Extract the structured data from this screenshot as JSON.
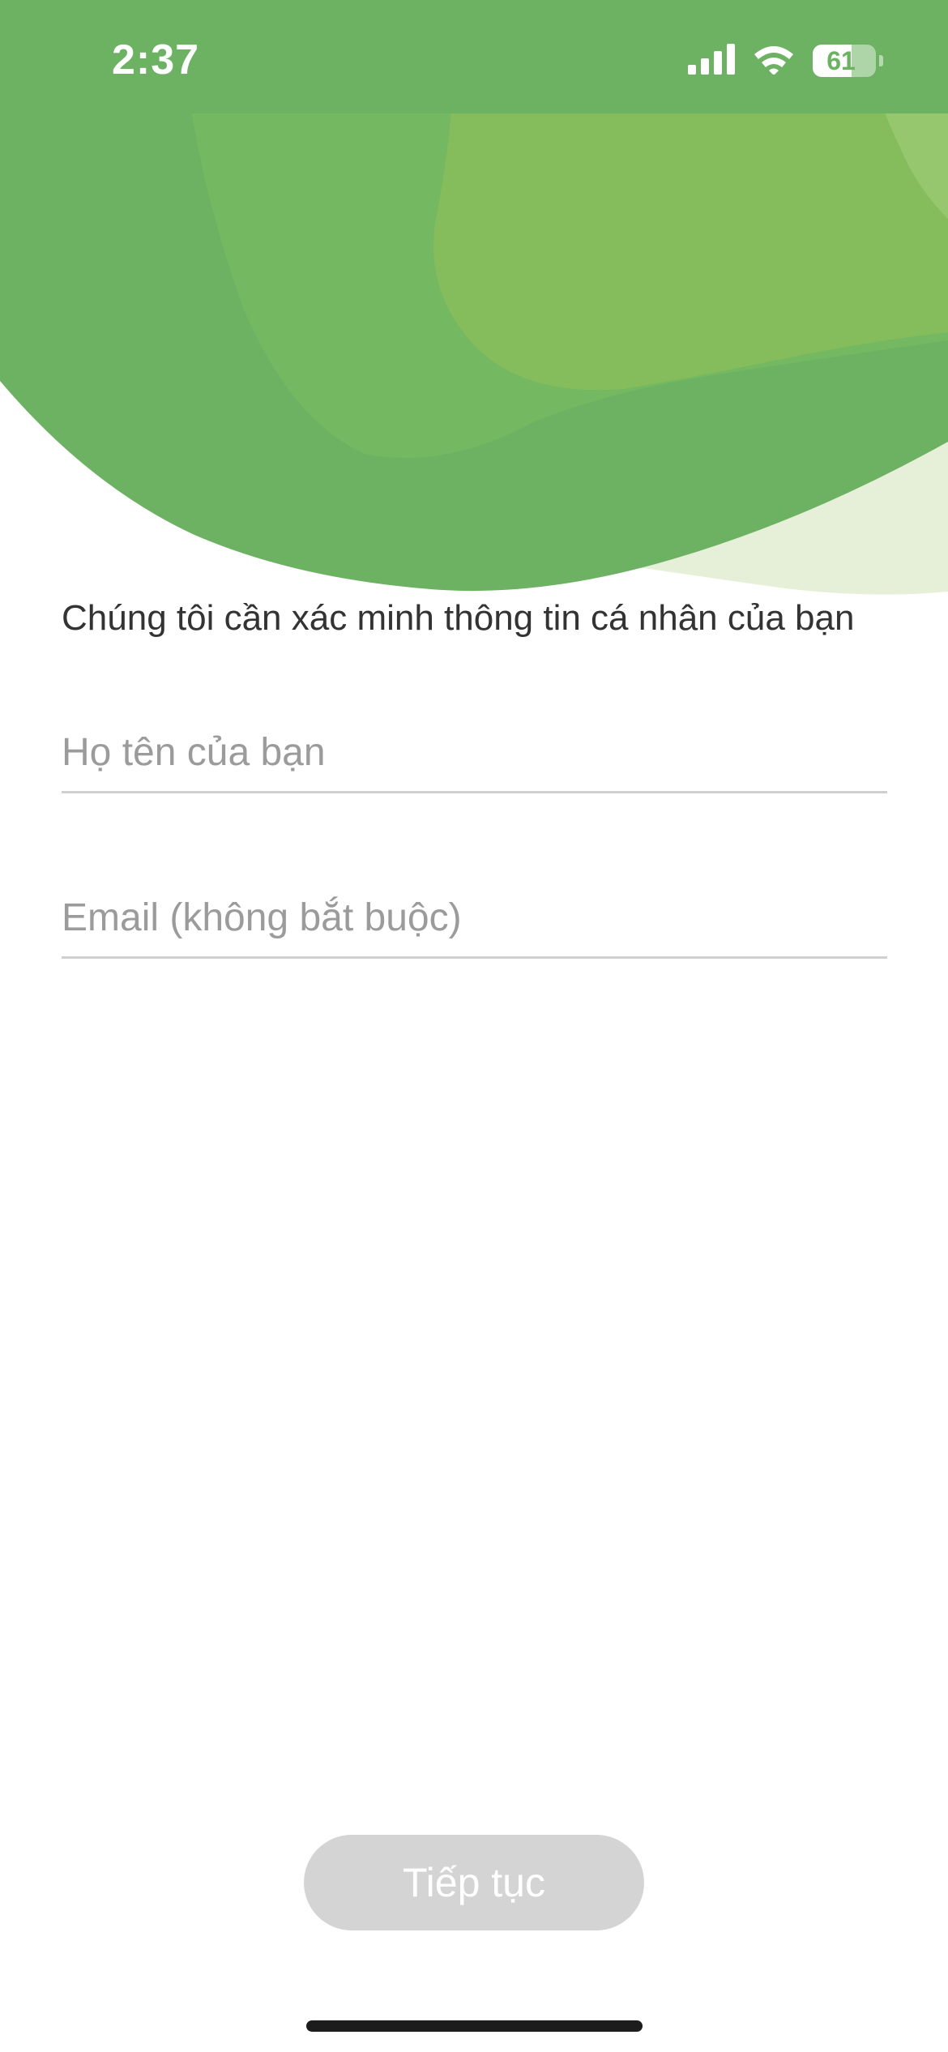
{
  "status_bar": {
    "time": "2:37",
    "battery_level": "61",
    "battery_fraction": 0.61,
    "icons": [
      "signal-icon",
      "wifi-icon",
      "battery-icon"
    ]
  },
  "header": {
    "colors": {
      "primary_green": "#6cb262",
      "light_green": "#85bd5c",
      "pale_green": "#e6f0d9"
    }
  },
  "form": {
    "subtitle": "Chúng tôi cần xác minh thông tin cá nhân của bạn",
    "name_field": {
      "placeholder": "Họ tên của bạn",
      "value": ""
    },
    "email_field": {
      "placeholder": "Email (không bắt buộc)",
      "value": ""
    },
    "continue_label": "Tiếp tục",
    "continue_enabled": false
  }
}
